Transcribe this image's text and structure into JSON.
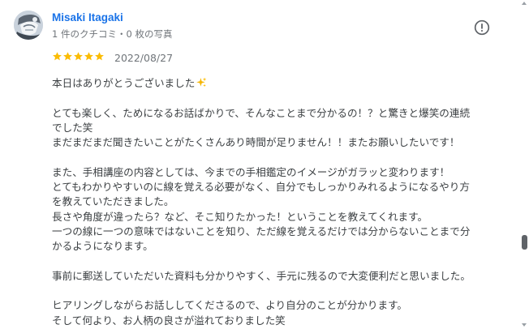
{
  "reviewer": {
    "name": "Misaki Itagaki",
    "meta": "1 件のクチコミ・0 枚の写真",
    "avatar_icon": "reviewer-avatar-icon"
  },
  "review": {
    "rating": 5,
    "max_rating": 5,
    "star_color": "#fbbc04",
    "date": "2022/08/27",
    "lines": [
      "本日はありがとうございました",
      "",
      "とても楽しく、ためになるお話ばかりで、そんなことまで分かるの！？と驚きと爆笑の連続",
      "でした笑",
      "まだまだまだ聞きたいことがたくさんあり時間が足りません！！またお願いしたいです！",
      "",
      "また、手相講座の内容としては、今までの手相鑑定のイメージがガラッと変わります！",
      "とてもわかりやすいのに線を覚える必要がなく、自分でもしっかりみれるようになるやり方",
      "を教えていただきました。",
      "長さや角度が違ったら？など、そこ知りたかった！ということを教えてくれます。",
      "一つの線に一つの意味ではないことを知り、ただ線を覚えるだけでは分からないことまで分",
      "かるようになります。",
      "",
      "事前に郵送していただいた資料も分かりやすく、手元に残るので大変便利だと思いました。",
      "",
      "ヒアリングしながらお話ししてくださるので、より自分のことが分かります。",
      "そして何より、お人柄の良さが溢れておりました笑"
    ],
    "sparkle_icon": "sparkle-emoji-icon"
  },
  "actions": {
    "report_icon": "report-flag-icon"
  },
  "colors": {
    "name": "#1a73e8",
    "meta": "#70757a",
    "text": "#3c4043"
  }
}
